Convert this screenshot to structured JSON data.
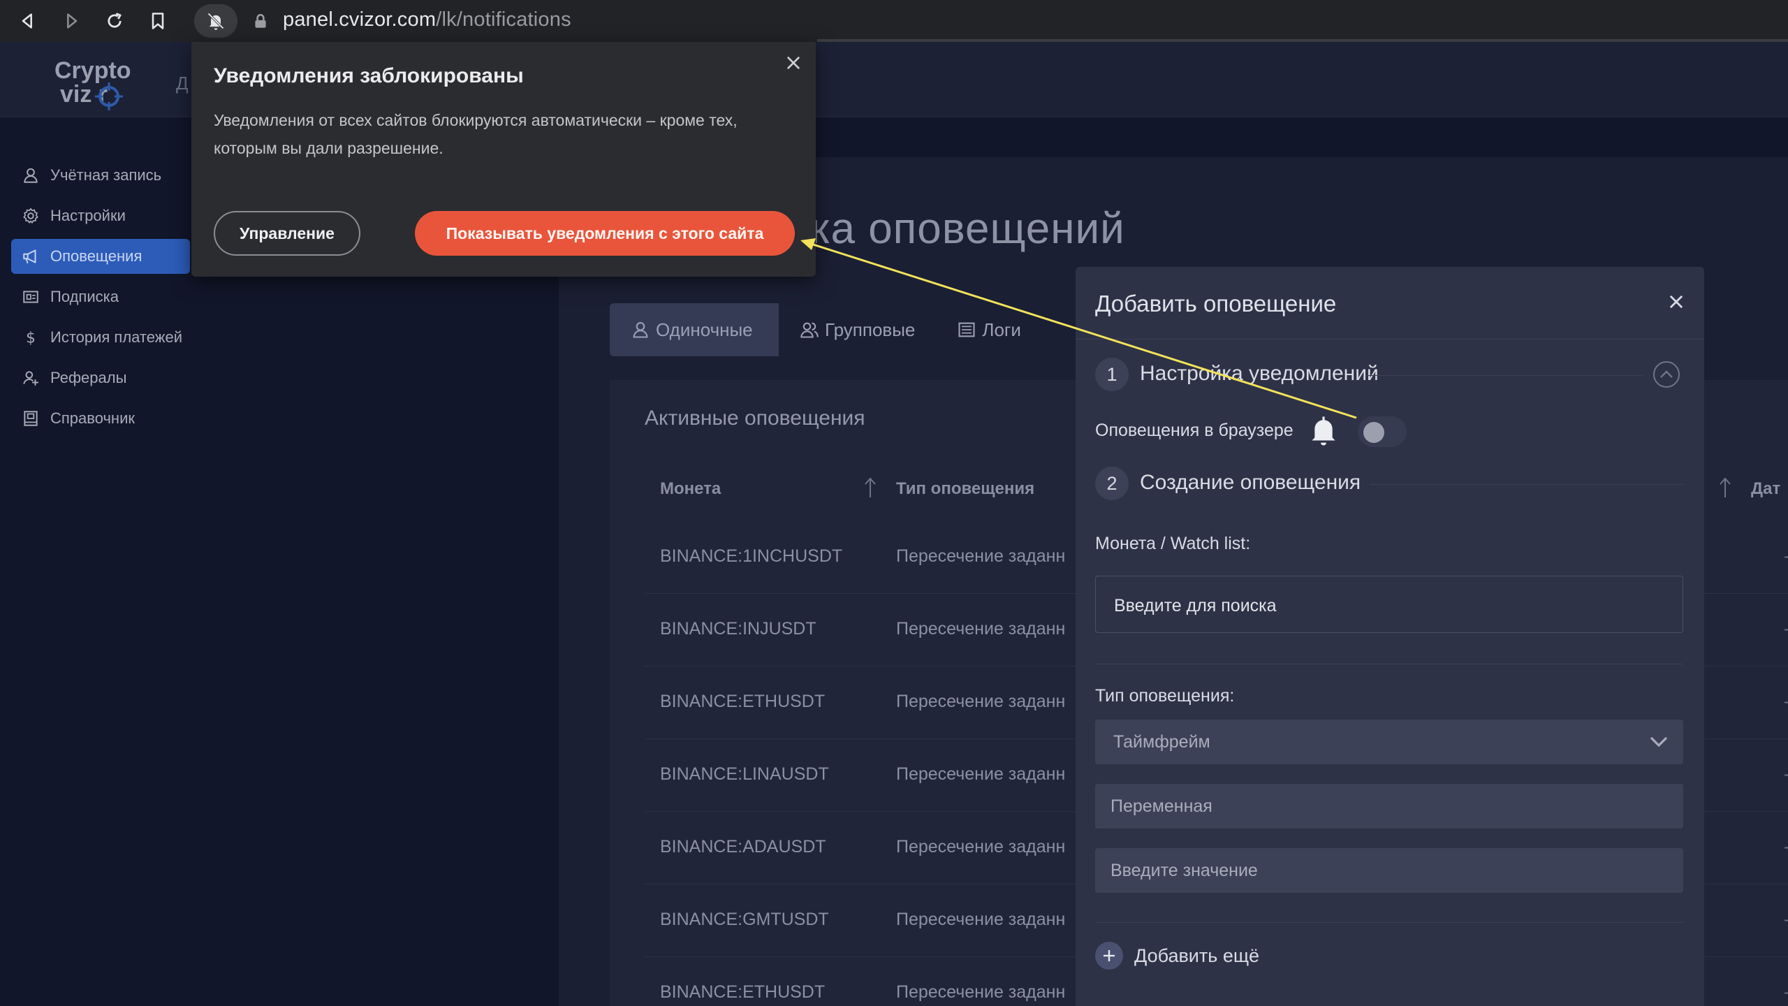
{
  "browser": {
    "url_host": "panel.cvizor.com",
    "url_path": "/lk/notifications"
  },
  "logo": {
    "line1": "Crypto",
    "line2": "viz r"
  },
  "header": {
    "partial_text": "Д"
  },
  "sidebar": {
    "items": [
      {
        "label": "Учётная запись",
        "icon": "user-icon"
      },
      {
        "label": "Настройки",
        "icon": "gear-icon"
      },
      {
        "label": "Оповещения",
        "icon": "megaphone-icon",
        "active": true
      },
      {
        "label": "Подписка",
        "icon": "subscription-icon"
      },
      {
        "label": "История платежей",
        "icon": "dollar-icon"
      },
      {
        "label": "Рефералы",
        "icon": "referral-icon"
      },
      {
        "label": "Справочник",
        "icon": "book-icon"
      }
    ]
  },
  "page": {
    "title_visible": "ка оповещений"
  },
  "tabs": [
    {
      "label": "Одиночные",
      "icon": "user-icon",
      "active": true
    },
    {
      "label": "Групповые",
      "icon": "group-icon"
    },
    {
      "label": "Логи",
      "icon": "log-icon"
    }
  ],
  "table": {
    "title": "Активные оповещения",
    "headers": {
      "coin": "Монета",
      "type": "Тип оповещения",
      "date": "Дат"
    },
    "rows": [
      {
        "coin": "BINANCE:1INCHUSDT",
        "type": "Пересечение заданн",
        "date": "-"
      },
      {
        "coin": "BINANCE:INJUSDT",
        "type": "Пересечение заданн",
        "date": "-"
      },
      {
        "coin": "BINANCE:ETHUSDT",
        "type": "Пересечение заданн",
        "date": "-"
      },
      {
        "coin": "BINANCE:LINAUSDT",
        "type": "Пересечение заданн",
        "date": "-"
      },
      {
        "coin": "BINANCE:ADAUSDT",
        "type": "Пересечение заданн",
        "date": "-"
      },
      {
        "coin": "BINANCE:GMTUSDT",
        "type": "Пересечение заданн",
        "date": "-"
      },
      {
        "coin": "BINANCE:ETHUSDT",
        "type": "Пересечение заданн",
        "date": "-"
      }
    ]
  },
  "modal": {
    "title": "Добавить оповещение",
    "step1": {
      "num": "1",
      "label": "Настройка уведомлений"
    },
    "browser_alerts_label": "Оповещения в браузере",
    "browser_alerts_enabled": false,
    "step2": {
      "num": "2",
      "label": "Создание оповещения"
    },
    "coin_label": "Монета / Watch list:",
    "coin_placeholder": "Введите для поиска",
    "type_label": "Тип оповещения:",
    "type_selected": "Таймфрейм",
    "variable_placeholder": "Переменная",
    "value_placeholder": "Введите значение",
    "add_more": "Добавить ещё"
  },
  "popup": {
    "title": "Уведомления заблокированы",
    "text": "Уведомления от всех сайтов блокируются автоматически – кроме тех, которым вы дали разрешение.",
    "manage_label": "Управление",
    "allow_label": "Показывать уведомления с этого сайта"
  },
  "colors": {
    "accent_orange": "#e9553b",
    "sidebar_active": "#2c5cb8",
    "annotation_arrow": "#f2e35b"
  }
}
